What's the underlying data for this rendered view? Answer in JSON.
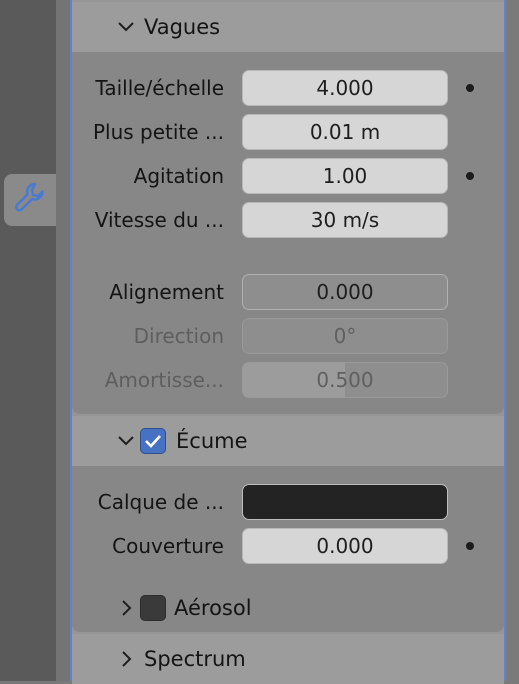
{
  "sidebar": {
    "active_tab_icon": "wrench-icon",
    "accent_color": "#5b84d6"
  },
  "vagues": {
    "title": "Vagues",
    "rows": [
      {
        "label": "Taille/échelle",
        "value": "4.000",
        "keyframe_dot": true
      },
      {
        "label": "Plus petite ...",
        "value": "0.01 m",
        "keyframe_dot": false
      },
      {
        "label": "Agitation",
        "value": "1.00",
        "keyframe_dot": true
      },
      {
        "label": "Vitesse du ...",
        "value": "30 m/s",
        "keyframe_dot": false
      },
      {
        "label": "Alignement",
        "value": "0.000",
        "keyframe_dot": false
      },
      {
        "label": "Direction",
        "value": "0°",
        "disabled": true
      },
      {
        "label": "Amortisse...",
        "value": "0.500",
        "disabled": true,
        "slider_fraction": 0.5
      }
    ]
  },
  "ecume": {
    "title": "Écume",
    "checked": true,
    "rows": [
      {
        "label": "Calque de ...",
        "value": "",
        "type": "color",
        "color": "#232323"
      },
      {
        "label": "Couverture",
        "value": "0.000",
        "keyframe_dot": true
      }
    ],
    "aerosol": {
      "title": "Aérosol",
      "checked": false
    }
  },
  "spectrum": {
    "title": "Spectrum"
  }
}
